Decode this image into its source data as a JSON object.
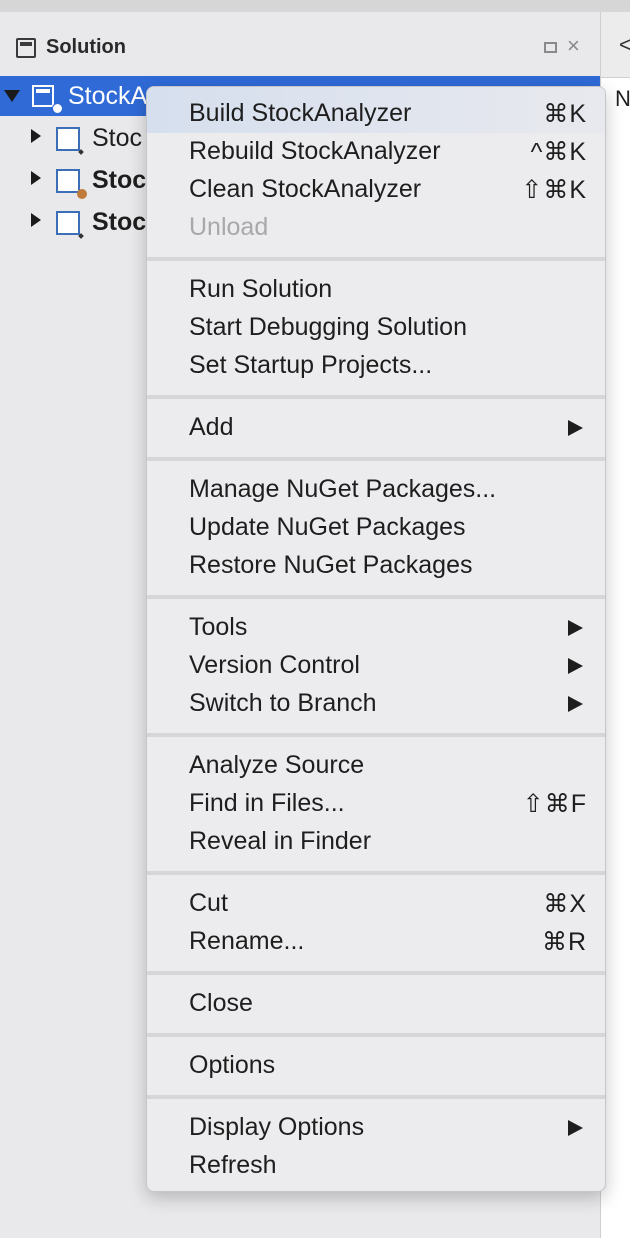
{
  "panel": {
    "title": "Solution",
    "maximize_icon": "maximize-icon",
    "close_glyph": "×"
  },
  "tree": {
    "solution_label": "StockA",
    "projects": [
      {
        "label": "Stoc",
        "bold": false
      },
      {
        "label": "Stoc",
        "bold": true
      },
      {
        "label": "Stoc",
        "bold": true
      }
    ]
  },
  "right_pane": {
    "tab_glyph": "<",
    "letter": "N"
  },
  "context_menu": {
    "items": [
      {
        "label": "Build StockAnalyzer",
        "shortcut": "⌘K"
      },
      {
        "label": "Rebuild StockAnalyzer",
        "shortcut": "^⌘K"
      },
      {
        "label": "Clean StockAnalyzer",
        "shortcut": "⇧⌘K"
      },
      {
        "label": "Unload",
        "disabled": true
      },
      {
        "label": "Run Solution"
      },
      {
        "label": "Start Debugging Solution"
      },
      {
        "label": "Set Startup Projects..."
      },
      {
        "label": "Add",
        "submenu": true
      },
      {
        "label": "Manage NuGet Packages..."
      },
      {
        "label": "Update NuGet Packages"
      },
      {
        "label": "Restore NuGet Packages"
      },
      {
        "label": "Tools",
        "submenu": true
      },
      {
        "label": "Version Control",
        "submenu": true
      },
      {
        "label": "Switch to Branch",
        "submenu": true
      },
      {
        "label": "Analyze Source"
      },
      {
        "label": "Find in Files...",
        "shortcut": "⇧⌘F"
      },
      {
        "label": "Reveal in Finder"
      },
      {
        "label": "Cut",
        "shortcut": "⌘X"
      },
      {
        "label": "Rename...",
        "shortcut": "⌘R"
      },
      {
        "label": "Close"
      },
      {
        "label": "Options"
      },
      {
        "label": "Display Options",
        "submenu": true
      },
      {
        "label": "Refresh"
      }
    ]
  },
  "colors": {
    "selection": "#2f6ad7",
    "menu_bg": "#ececee",
    "disabled_text": "#a8a8aa"
  }
}
